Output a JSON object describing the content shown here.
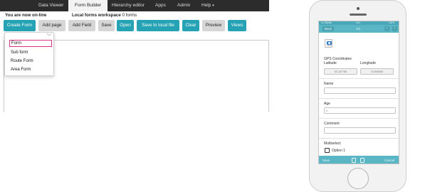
{
  "nav": {
    "tabs": [
      "Data Viewer",
      "Form Builder",
      "Hierarchy editor",
      "Apps",
      "Admin",
      "Help"
    ],
    "active_tab": "Form Builder"
  },
  "status": {
    "online": "You are now on-line",
    "workspace_label": "Local forms workspace",
    "workspace_count": "0 forms"
  },
  "toolbar": {
    "create_form": "Create Form",
    "add_page": "Add page",
    "add_field": "Add Field",
    "save": "Save",
    "open": "Open",
    "save_local": "Save to local file",
    "clear": "Clear",
    "preview": "Preview",
    "views": "Views"
  },
  "dropdown": {
    "items": [
      "Form",
      "Sub form",
      "Route Form",
      "Area Form"
    ],
    "selected": "Form"
  },
  "phone": {
    "status_bar": {
      "carrier": "•••• Sketch",
      "time": "9:41",
      "battery": "100%"
    },
    "back": "Back",
    "pager": "1/1",
    "prev": "‹",
    "next": "›",
    "camera_caption": "photo",
    "gps_label": "GPS Coordinates",
    "latitude_label": "Latitude",
    "longitude_label": "Longitude",
    "latitude_value": "60.167786",
    "longitude_value": "24.806065",
    "name_label": "Name",
    "name_value": "",
    "age_label": "Age",
    "age_value": "0",
    "comment_label": "Comment",
    "comment_value": "",
    "multiselect_label": "Multiselect",
    "option1": "Option 1",
    "save": "Save",
    "cancel": "Cancel"
  },
  "colors": {
    "nav_bg": "#2c2c2c",
    "accent": "#25a2b3",
    "button_grey": "#d6d6d6",
    "selection": "#d63384",
    "phone_bar": "#5ab6c4"
  }
}
